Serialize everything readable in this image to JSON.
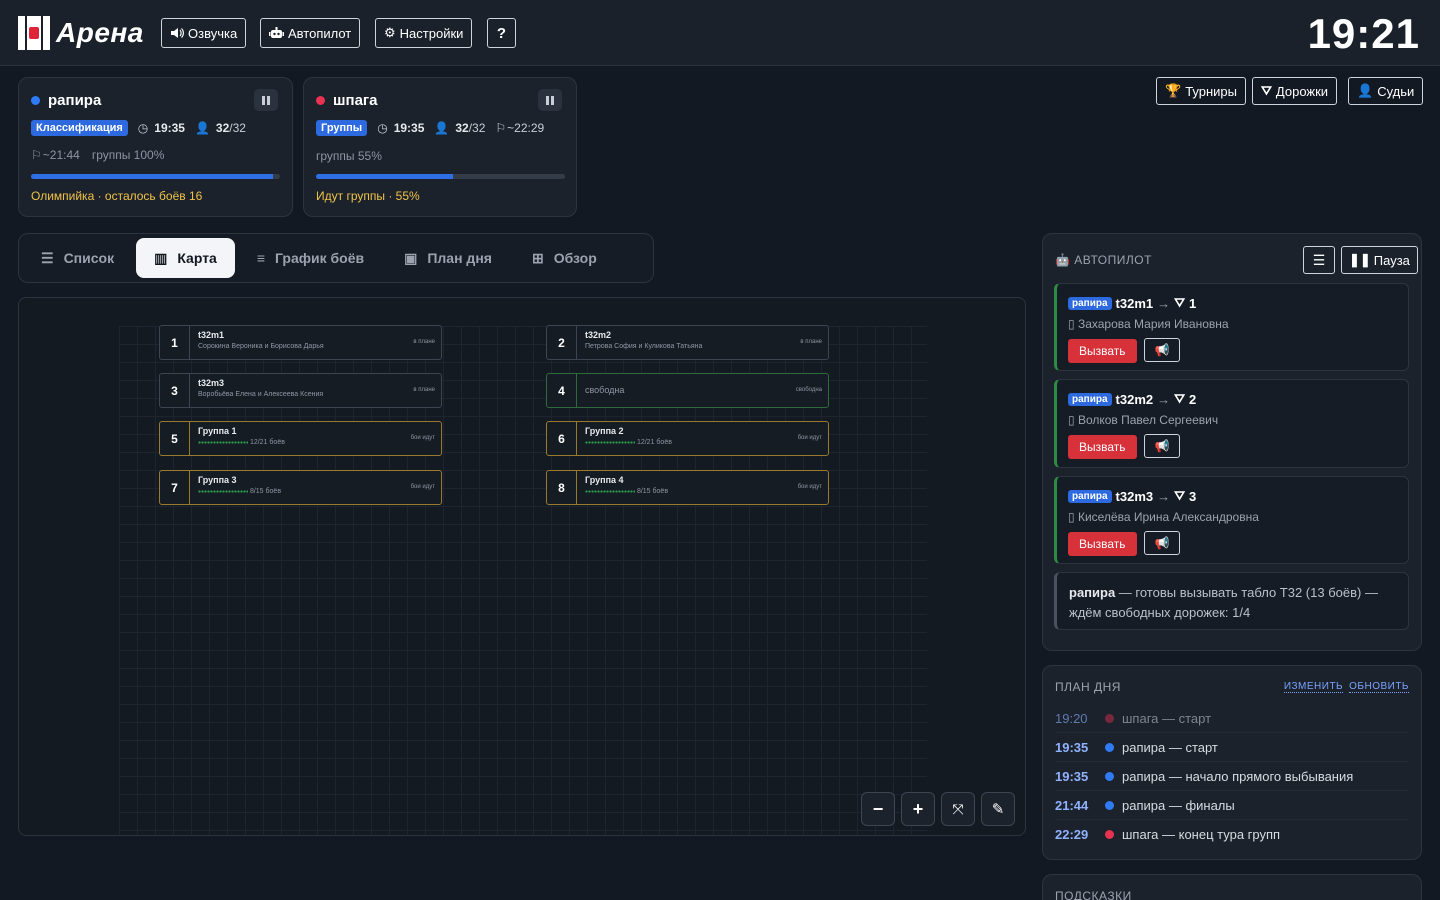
{
  "header": {
    "logo": "Арена",
    "buttons": {
      "voice": "Озвучка",
      "autopilot": "Автопилот",
      "settings": "Настройки",
      "help": "?"
    },
    "clock": "19:21"
  },
  "weapons": [
    {
      "name": "рапира",
      "color": "#2f7bf5",
      "stage": "Классификация",
      "time": "19:35",
      "count": "32",
      "total": "/32",
      "finish": "~21:44",
      "progress_text": "группы 100%",
      "progress": 0.97,
      "note": "Олимпийка · осталось боёв 16"
    },
    {
      "name": "шпага",
      "color": "#e83250",
      "stage": "Группы",
      "time": "19:35",
      "count": "32",
      "total": "/32",
      "finish": "~22:29",
      "progress_text": "группы 55%",
      "progress": 0.55,
      "note": "Идут группы · 55%"
    }
  ],
  "right_buttons": {
    "tournaments": "Турниры",
    "lanes": "Дорожки",
    "judges": "Судьи"
  },
  "tabs": {
    "list": "Список",
    "map": "Карта",
    "schedule": "График боёв",
    "dayplan": "План дня",
    "overview": "Обзор"
  },
  "lanes": [
    {
      "num": "1",
      "name": "t32m1",
      "sub": "Сорокина Вероника и Борисова Дарья",
      "status": "в плане"
    },
    {
      "num": "2",
      "name": "t32m2",
      "sub": "Петрова София и Куликова Татьяна",
      "status": "в плане"
    },
    {
      "num": "3",
      "name": "t32m3",
      "sub": "Воробьёва Елена и Алексеева Ксения",
      "status": "в плане"
    },
    {
      "num": "4",
      "name": "свободна",
      "sub": "",
      "status": "свободна"
    },
    {
      "num": "5",
      "name": "Группа 1",
      "sub": "12/21 боёв",
      "status": "бои идут"
    },
    {
      "num": "6",
      "name": "Группа 2",
      "sub": "12/21 боёв",
      "status": "бои идут"
    },
    {
      "num": "7",
      "name": "Группа 3",
      "sub": "8/15 боёв",
      "status": "бои идут"
    },
    {
      "num": "8",
      "name": "Группа 4",
      "sub": "8/15 боёв",
      "status": "бои идут"
    }
  ],
  "autopilot": {
    "title": "АВТОПИЛОТ",
    "pause": "Пауза",
    "call_label": "Вызвать",
    "arrow": "→",
    "items": [
      {
        "chip": "рапира",
        "bout": "t32m1",
        "lane": "1",
        "ref": "Захарова Мария Ивановна"
      },
      {
        "chip": "рапира",
        "bout": "t32m2",
        "lane": "2",
        "ref": "Волков Павел Сергеевич"
      },
      {
        "chip": "рапира",
        "bout": "t32m3",
        "lane": "3",
        "ref": "Киселёва Ирина Александровна"
      }
    ],
    "msg_bold": "рапира",
    "msg_rest": " — готовы вызывать табло T32 (13 боёв) — ждём свободных дорожек: 1/4"
  },
  "dayplan": {
    "title": "ПЛАН ДНЯ",
    "edit": "ИЗМЕНИТЬ",
    "refresh": "ОБНОВИТЬ",
    "rows": [
      {
        "time": "19:20",
        "text": "шпага — старт",
        "color": "#e83250",
        "past": true
      },
      {
        "time": "19:35",
        "text": "рапира — старт",
        "color": "#2f7bf5",
        "past": false
      },
      {
        "time": "19:35",
        "text": "рапира — начало прямого выбывания",
        "color": "#2f7bf5",
        "past": false
      },
      {
        "time": "21:44",
        "text": "рапира — финалы",
        "color": "#2f7bf5",
        "past": false
      },
      {
        "time": "22:29",
        "text": "шпага — конец тура групп",
        "color": "#e83250",
        "past": false
      }
    ]
  },
  "hints": {
    "title": "ПОДСКАЗКИ"
  }
}
